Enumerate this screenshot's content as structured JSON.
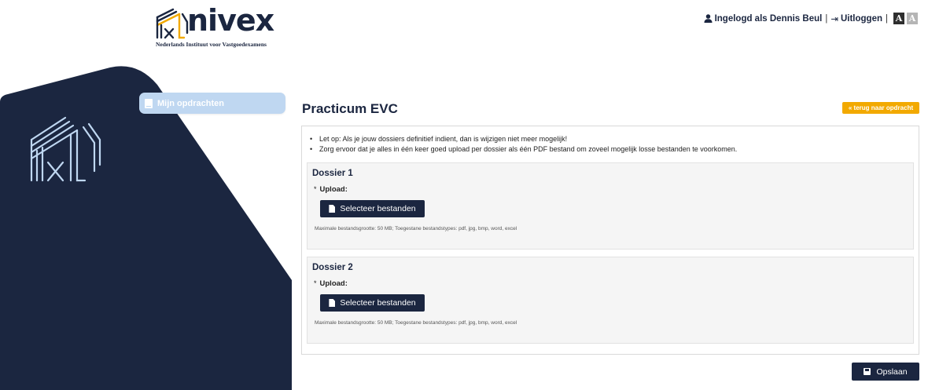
{
  "brand": {
    "name": "nivex",
    "subtitle": "Nederlands Instituut voor Vastgoedexamens",
    "navy": "#1b2640",
    "accent": "#f2a900",
    "sidebar_highlight": "#bfd7f1"
  },
  "topbar": {
    "user_icon": "user-icon",
    "logged_in_text": "Ingelogd als Dennis Beul",
    "separator": "|",
    "logout_icon": "logout-icon",
    "logout_label": "Uitloggen",
    "font_large": "A",
    "font_small": "A"
  },
  "sidebar": {
    "items": [
      {
        "icon": "book-icon",
        "label": "Mijn opdrachten",
        "active": true
      }
    ]
  },
  "main": {
    "title": "Practicum EVC",
    "back_label": "« terug naar opdracht",
    "notes": [
      "Let op: Als je jouw dossiers definitief indient, dan is wijzigen niet meer mogelijk!",
      "Zorg ervoor dat je alles in één keer goed upload per dossier als één PDF bestand om zoveel mogelijk losse bestanden te voorkomen."
    ],
    "dossiers": [
      {
        "title": "Dossier 1",
        "required_mark": "*",
        "upload_label": "Upload:",
        "button_label": "Selecteer bestanden",
        "help": "Maximale bestandsgrootte: 50 MB; Toegestane bestandstypes: pdf, jpg, bmp, word, excel"
      },
      {
        "title": "Dossier 2",
        "required_mark": "*",
        "upload_label": "Upload:",
        "button_label": "Selecteer bestanden",
        "help": "Maximale bestandsgrootte: 50 MB; Toegestane bestandstypes: pdf, jpg, bmp, word, excel"
      }
    ],
    "save_label": "Opslaan"
  }
}
